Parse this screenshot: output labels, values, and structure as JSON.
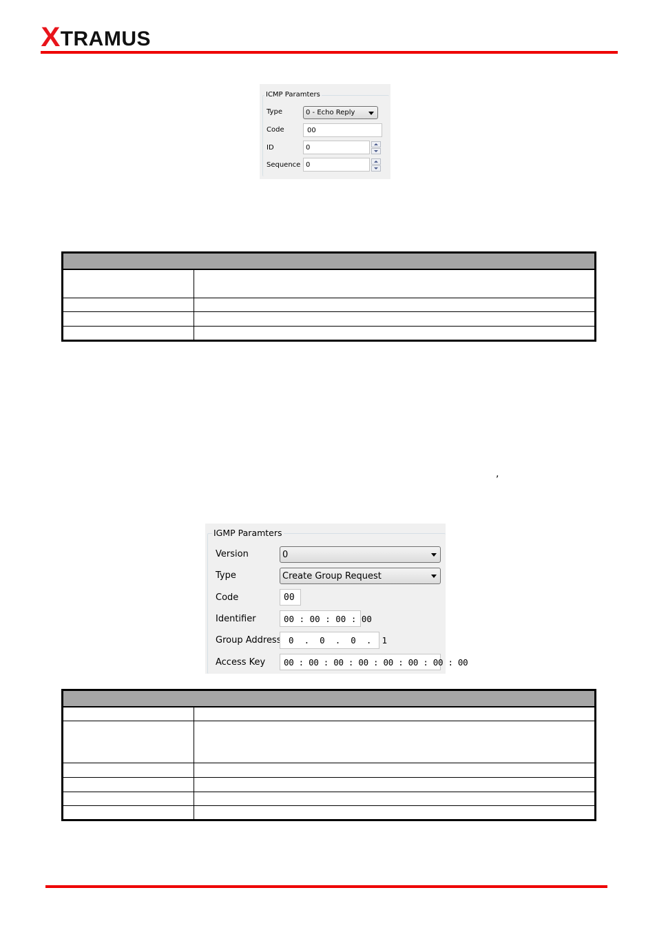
{
  "header": {
    "logo_initial": "X",
    "logo_rest": "TRAMUS",
    "accent_color": "#ee0000"
  },
  "icmp_panel": {
    "title": "ICMP Paramters",
    "fields": {
      "type": {
        "label": "Type",
        "value": "0 - Echo Reply"
      },
      "code": {
        "label": "Code",
        "value": "00"
      },
      "id": {
        "label": "ID",
        "value": "0"
      },
      "sequence": {
        "label": "Sequence",
        "value": "0"
      }
    }
  },
  "table1": {
    "header": "",
    "rows": [
      [
        "",
        ""
      ],
      [
        "",
        ""
      ],
      [
        "",
        ""
      ],
      [
        "",
        ""
      ]
    ]
  },
  "stray_text": {
    "comma": ","
  },
  "igmp_panel": {
    "title": "IGMP Paramters",
    "fields": {
      "version": {
        "label": "Version",
        "value": "0"
      },
      "type": {
        "label": "Type",
        "value": "Create Group Request"
      },
      "code": {
        "label": "Code",
        "value": "00"
      },
      "identifier": {
        "label": "Identifier",
        "value": "00 : 00 : 00 : 00"
      },
      "group_address": {
        "label": "Group Address",
        "value": "0  .  0  .  0  .  1"
      },
      "access_key": {
        "label": "Access Key",
        "value": "00 : 00 : 00 : 00 : 00 : 00 : 00 : 00"
      }
    }
  },
  "table2": {
    "header": "",
    "rows": [
      [
        "",
        ""
      ],
      [
        "",
        ""
      ],
      [
        "",
        ""
      ],
      [
        "",
        ""
      ],
      [
        "",
        ""
      ],
      [
        "",
        ""
      ]
    ]
  }
}
